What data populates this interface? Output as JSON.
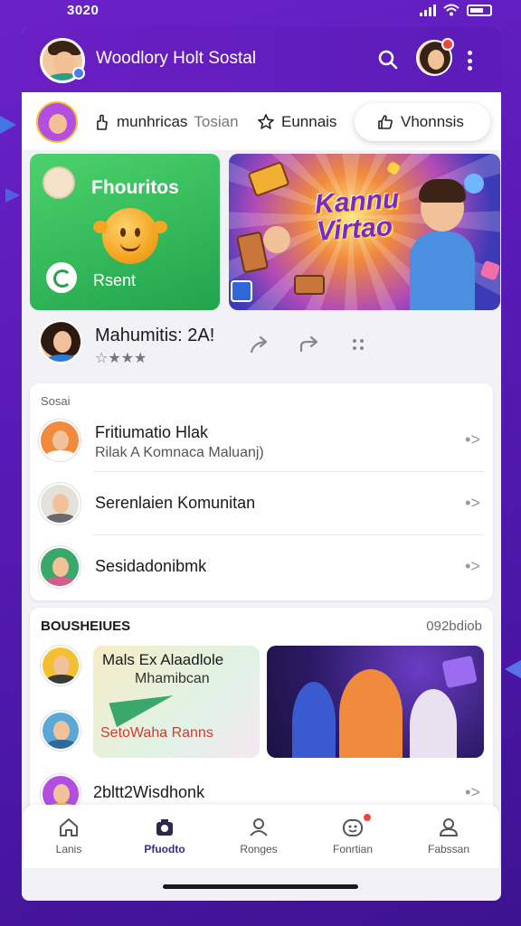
{
  "status_bar": {
    "time": "3020"
  },
  "header": {
    "title": "Woodlory Holt Sostal"
  },
  "filters": {
    "chip1_strong": "munhricas",
    "chip1_muted": "Tosian",
    "chip2": "Eunnais",
    "chip3": "Vhonnsis"
  },
  "featured": {
    "green_title": "Fhouritos",
    "green_action": "Rsent",
    "game_title": "Kannu Virtao"
  },
  "post": {
    "title": "Mahumitis: 2A!",
    "rating": "☆★★★"
  },
  "suggestions": {
    "section_label": "Sosai",
    "items": [
      {
        "title": "Fritiumatio Hlak",
        "subtitle": "Rilak A Komnaca Maluanj)",
        "chevron": "•>"
      },
      {
        "title": "Serenlaien Komunitan",
        "subtitle": "",
        "chevron": "•>"
      },
      {
        "title": "Sesidadonibmk",
        "subtitle": "",
        "chevron": "•>"
      }
    ]
  },
  "bottom": {
    "heading": "BOUSHEIUES",
    "meta": "092bdiob",
    "promo_title": "Mals Ex Alaadlole",
    "promo_sub": "Mhamibcan",
    "promo_cta": "SetoWaha Ranns",
    "item_title": "2bltt2Wisdhonk",
    "chevron": "•>"
  },
  "tabs": [
    {
      "label": "Lanis",
      "icon": "home-icon"
    },
    {
      "label": "Pfuodto",
      "icon": "camera-icon",
      "active": true
    },
    {
      "label": "Ronges",
      "icon": "person-icon"
    },
    {
      "label": "Fonrtian",
      "icon": "emoji-icon",
      "badge": true
    },
    {
      "label": "Fabssan",
      "icon": "profile-icon"
    }
  ],
  "colors": {
    "brand_purple": "#6a1fc4",
    "green_banner": "#2bb357",
    "notification_red": "#e8473a",
    "promo_cta_red": "#d33a2f"
  }
}
